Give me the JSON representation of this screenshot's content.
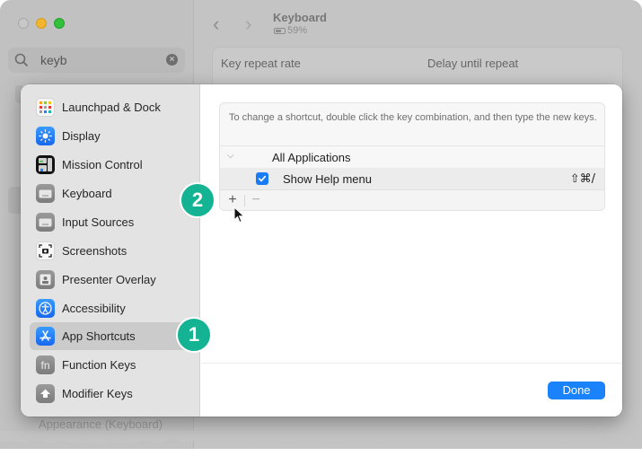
{
  "background_window": {
    "search": {
      "value": "keyb",
      "clear_icon": "clear-circle-icon",
      "search_icon": "magnifying-glass-icon"
    },
    "title": "Keyboard",
    "battery": "59%",
    "settings": {
      "key_repeat_label": "Key repeat rate",
      "delay_label": "Delay until repeat"
    },
    "sidebar_bottom_item": "Appearance (Keyboard)"
  },
  "dialog": {
    "sidebar": {
      "items": [
        {
          "label": "Launchpad & Dock",
          "icon": "launchpad-icon",
          "selected": false
        },
        {
          "label": "Display",
          "icon": "display-icon",
          "selected": false
        },
        {
          "label": "Mission Control",
          "icon": "mission-control-icon",
          "selected": false
        },
        {
          "label": "Keyboard",
          "icon": "keyboard-icon",
          "selected": false
        },
        {
          "label": "Input Sources",
          "icon": "input-sources-icon",
          "selected": false
        },
        {
          "label": "Screenshots",
          "icon": "screenshot-icon",
          "selected": false
        },
        {
          "label": "Presenter Overlay",
          "icon": "presenter-overlay-icon",
          "selected": false
        },
        {
          "label": "Accessibility",
          "icon": "accessibility-icon",
          "selected": false
        },
        {
          "label": "App Shortcuts",
          "icon": "app-store-icon",
          "selected": true
        },
        {
          "label": "Function Keys",
          "icon": "fn-icon",
          "selected": false
        },
        {
          "label": "Modifier Keys",
          "icon": "modifier-arrow-icon",
          "selected": false
        }
      ]
    },
    "main": {
      "hint": "To change a shortcut, double click the key combination, and then type the new keys.",
      "group": {
        "label": "All Applications",
        "expanded": true
      },
      "shortcuts": [
        {
          "label": "Show Help menu",
          "enabled": true,
          "keys": "⇧⌘/"
        }
      ],
      "toolbar": {
        "add": "+",
        "remove": "−"
      },
      "done_label": "Done"
    }
  },
  "annotations": {
    "badge1": "1",
    "badge2": "2",
    "color": "#14b394"
  },
  "colors": {
    "accent": "#1a82fb"
  }
}
